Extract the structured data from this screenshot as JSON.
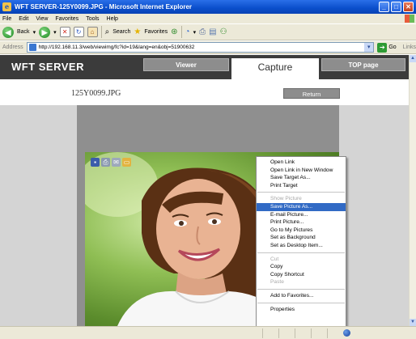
{
  "window": {
    "title": "WFT SERVER-125Y0099.JPG - Microsoft Internet Explorer",
    "controls": [
      "_",
      "□",
      "✕"
    ]
  },
  "menu": [
    "File",
    "Edit",
    "View",
    "Favorites",
    "Tools",
    "Help"
  ],
  "toolbar": {
    "back_label": "Back",
    "search_label": "Search",
    "favorites_label": "Favorites"
  },
  "address": {
    "label": "Address",
    "url": "http://192.168.11.3/web/viewimg/fc?id=19&lang=en&obj=51900632",
    "go_label": "Go",
    "links_label": "Links"
  },
  "page": {
    "title": "WFT SERVER",
    "tabs": {
      "viewer": "Viewer",
      "capture": "Capture",
      "top": "TOP page"
    },
    "filename": "125Y0099.JPG",
    "return_label": "Return"
  },
  "context_menu": [
    {
      "label": "Open Link",
      "state": "enabled"
    },
    {
      "label": "Open Link in New Window",
      "state": "enabled"
    },
    {
      "label": "Save Target As...",
      "state": "enabled"
    },
    {
      "label": "Print Target",
      "state": "enabled"
    },
    {
      "sep": true
    },
    {
      "label": "Show Picture",
      "state": "disabled"
    },
    {
      "label": "Save Picture As...",
      "state": "selected"
    },
    {
      "label": "E-mail Picture...",
      "state": "enabled"
    },
    {
      "label": "Print Picture...",
      "state": "enabled"
    },
    {
      "label": "Go to My Pictures",
      "state": "enabled"
    },
    {
      "label": "Set as Background",
      "state": "enabled"
    },
    {
      "label": "Set as Desktop Item...",
      "state": "enabled"
    },
    {
      "sep": true
    },
    {
      "label": "Cut",
      "state": "disabled"
    },
    {
      "label": "Copy",
      "state": "enabled"
    },
    {
      "label": "Copy Shortcut",
      "state": "enabled"
    },
    {
      "label": "Paste",
      "state": "disabled"
    },
    {
      "sep": true
    },
    {
      "label": "Add to Favorites...",
      "state": "enabled"
    },
    {
      "sep": true
    },
    {
      "label": "Properties",
      "state": "enabled"
    }
  ],
  "colors": {
    "titlebar": "#0a4ecb",
    "page_header": "#3b3b3b",
    "tab_gray": "#8d8d8d",
    "menu_highlight": "#316ac5"
  }
}
